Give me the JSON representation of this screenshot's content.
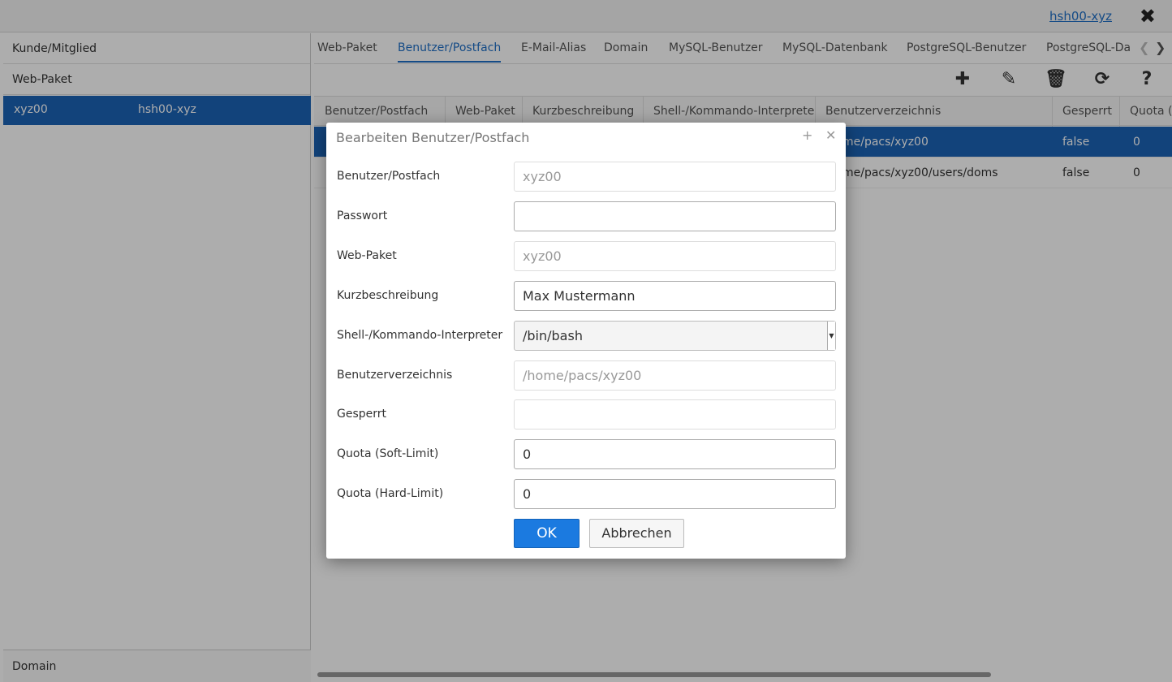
{
  "topbar": {
    "user_link": "hsh00-xyz",
    "close_glyph": "✖"
  },
  "left": {
    "header_customer": "Kunde/Mitglied",
    "header_webpaket": "Web-Paket",
    "selected_row": {
      "name": "xyz00",
      "member": "hsh00-xyz"
    },
    "bottom_label": "Domain"
  },
  "tabs": [
    "Web-Paket",
    "Benutzer/Postfach",
    "E-Mail-Alias",
    "Domain",
    "MySQL-Benutzer",
    "MySQL-Datenbank",
    "PostgreSQL-Benutzer",
    "PostgreSQL-Da"
  ],
  "active_tab": "Benutzer/Postfach",
  "toolbar_icons": [
    "plus-icon",
    "edit-icon",
    "trash-icon",
    "refresh-icon",
    "help-icon"
  ],
  "grid": {
    "columns": [
      "Benutzer/Postfach",
      "Web-Paket",
      "Kurzbeschreibung",
      "Shell-/Kommando-Interpreter",
      "Benutzerverzeichnis",
      "Gesperrt",
      "Quota (S"
    ],
    "rows": [
      {
        "dir": "me/pacs/xyz00",
        "gesperrt": "false",
        "quota": "0"
      },
      {
        "dir": "me/pacs/xyz00/users/doms",
        "gesperrt": "false",
        "quota": "0"
      }
    ]
  },
  "dialog": {
    "title": "Bearbeiten Benutzer/Postfach",
    "fields": [
      {
        "label": "Benutzer/Postfach",
        "value": "xyz00"
      },
      {
        "label": "Passwort",
        "value": ""
      },
      {
        "label": "Web-Paket",
        "value": "xyz00"
      },
      {
        "label": "Kurzbeschreibung",
        "value": "Max Mustermann"
      },
      {
        "label": "Shell-/Kommando-Interpreter",
        "value": "/bin/bash"
      },
      {
        "label": "Benutzerverzeichnis",
        "value": "/home/pacs/xyz00"
      },
      {
        "label": "Gesperrt",
        "value": ""
      },
      {
        "label": "Quota (Soft-Limit)",
        "value": "0"
      },
      {
        "label": "Quota (Hard-Limit)",
        "value": "0"
      }
    ],
    "ok_label": "OK",
    "cancel_label": "Abbrechen"
  }
}
